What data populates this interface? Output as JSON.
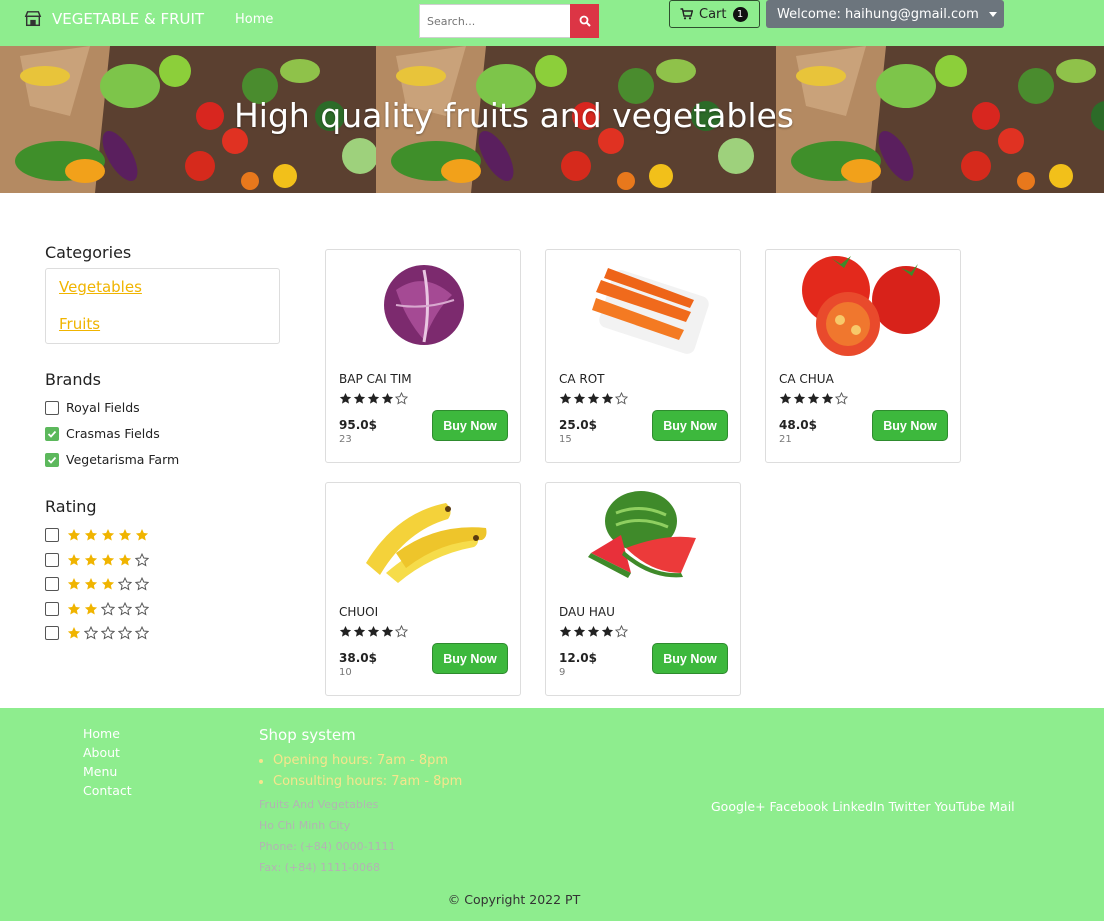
{
  "navbar": {
    "brand": "VEGETABLE & FRUIT",
    "home": "Home",
    "search_placeholder": "Search...",
    "cart_label": "Cart",
    "cart_count": "1",
    "welcome": "Welcome: haihung@gmail.com"
  },
  "banner": {
    "title": "High quality fruits and vegetables"
  },
  "sidebar": {
    "categories_title": "Categories",
    "categories": [
      "Vegetables",
      "Fruits"
    ],
    "brands_title": "Brands",
    "brands": [
      {
        "label": "Royal Fields",
        "checked": false
      },
      {
        "label": "Crasmas Fields",
        "checked": true
      },
      {
        "label": "Vegetarisma Farm",
        "checked": true
      }
    ],
    "rating_title": "Rating",
    "ratings": [
      5,
      4,
      3,
      2,
      1
    ]
  },
  "products": [
    {
      "name": "BAP CAI TIM",
      "price": "95.0$",
      "sold": "23",
      "rating": 4,
      "buy": "Buy Now",
      "image": "red-cabbage"
    },
    {
      "name": "CA ROT",
      "price": "25.0$",
      "sold": "15",
      "rating": 4,
      "buy": "Buy Now",
      "image": "carrot"
    },
    {
      "name": "CA CHUA",
      "price": "48.0$",
      "sold": "21",
      "rating": 4,
      "buy": "Buy Now",
      "image": "tomato"
    },
    {
      "name": "CHUOI",
      "price": "38.0$",
      "sold": "10",
      "rating": 4,
      "buy": "Buy Now",
      "image": "banana"
    },
    {
      "name": "DAU HAU",
      "price": "12.0$",
      "sold": "9",
      "rating": 4,
      "buy": "Buy Now",
      "image": "watermelon"
    }
  ],
  "footer": {
    "links": [
      "Home",
      "About",
      "Menu",
      "Contact"
    ],
    "shop_title": "Shop system",
    "hours": [
      "Opening hours: 7am - 8pm",
      "Consulting hours: 7am - 8pm"
    ],
    "info": [
      "Fruits And Vegetables",
      "Ho Chi Minh City",
      "Phone: (+84) 0000-1111",
      "Fax: (+84) 1111-0068"
    ],
    "social": "Google+ Facebook LinkedIn Twitter YouTube Mail",
    "copyright": "© Copyright 2022 PT"
  },
  "colors": {
    "nav_green": "#8eed8e",
    "buy_green": "#3db83d",
    "search_red": "#dc3545",
    "star_gold": "#f0b400",
    "link_gold": "#f0b400"
  }
}
